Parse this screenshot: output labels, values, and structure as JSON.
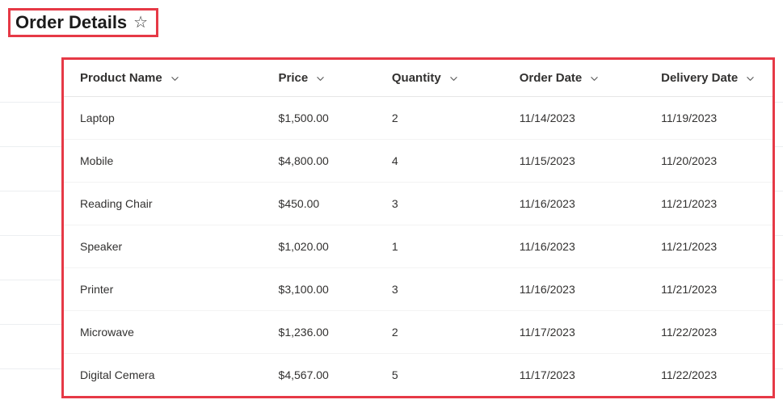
{
  "header": {
    "title": "Order Details"
  },
  "table": {
    "columns": {
      "product_name": "Product Name",
      "price": "Price",
      "quantity": "Quantity",
      "order_date": "Order Date",
      "delivery_date": "Delivery Date"
    },
    "rows": [
      {
        "product_name": "Laptop",
        "price": "$1,500.00",
        "quantity": "2",
        "order_date": "11/14/2023",
        "delivery_date": "11/19/2023"
      },
      {
        "product_name": "Mobile",
        "price": "$4,800.00",
        "quantity": "4",
        "order_date": "11/15/2023",
        "delivery_date": "11/20/2023"
      },
      {
        "product_name": "Reading Chair",
        "price": "$450.00",
        "quantity": "3",
        "order_date": "11/16/2023",
        "delivery_date": "11/21/2023"
      },
      {
        "product_name": "Speaker",
        "price": "$1,020.00",
        "quantity": "1",
        "order_date": "11/16/2023",
        "delivery_date": "11/21/2023"
      },
      {
        "product_name": "Printer",
        "price": "$3,100.00",
        "quantity": "3",
        "order_date": "11/16/2023",
        "delivery_date": "11/21/2023"
      },
      {
        "product_name": "Microwave",
        "price": "$1,236.00",
        "quantity": "2",
        "order_date": "11/17/2023",
        "delivery_date": "11/22/2023"
      },
      {
        "product_name": "Digital Cemera",
        "price": "$4,567.00",
        "quantity": "5",
        "order_date": "11/17/2023",
        "delivery_date": "11/22/2023"
      }
    ]
  }
}
